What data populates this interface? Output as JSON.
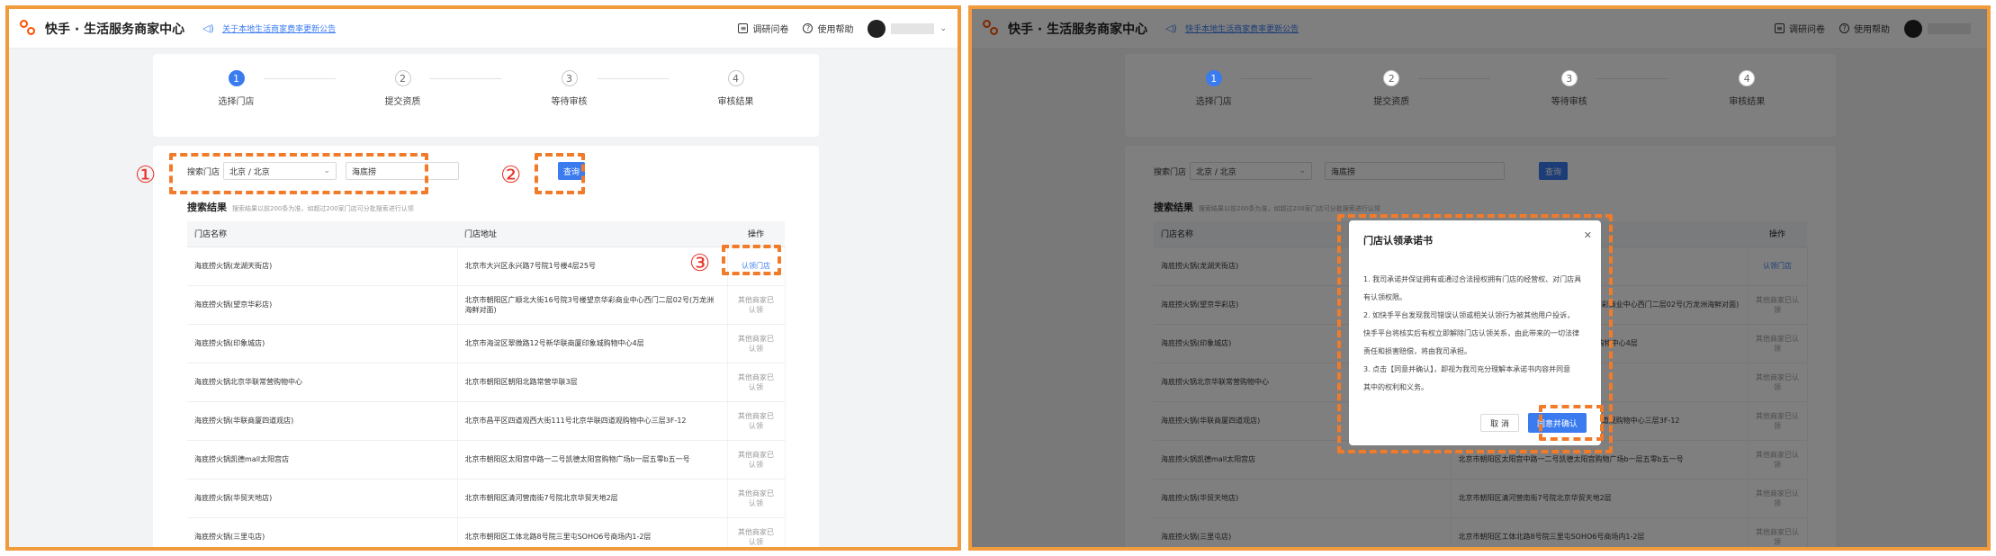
{
  "header": {
    "brand": "快手 · 生活服务商家中心",
    "notice_left": "关于本地生活商家费率更新公告",
    "notice_right": "快手本地生活商家费率更新公告",
    "survey": "调研问卷",
    "help": "使用帮助"
  },
  "steps": [
    {
      "num": "1",
      "label": "选择门店"
    },
    {
      "num": "2",
      "label": "提交资质"
    },
    {
      "num": "3",
      "label": "等待审核"
    },
    {
      "num": "4",
      "label": "审核结果"
    }
  ],
  "search": {
    "label": "搜索门店",
    "region": "北京 / 北京",
    "keyword": "海底捞",
    "button": "查询"
  },
  "results": {
    "title": "搜索结果",
    "hint": "搜索结果以前200条为准，如超过200家门店可分批搜索进行认领",
    "columns": [
      "门店名称",
      "门店地址",
      "操作"
    ],
    "rows": [
      {
        "name": "海底捞火锅(龙湖天街店)",
        "address": "北京市大兴区永兴路7号院1号楼4层25号",
        "action": "认领门店",
        "claimable": true
      },
      {
        "name": "海底捞火锅(望京华彩店)",
        "address": "北京市朝阳区广顺北大街16号院3号楼望京华彩商业中心西门二层02号(万龙洲海鲜对面)",
        "action": "其他商家已认领",
        "claimable": false
      },
      {
        "name": "海底捞火锅(印象城店)",
        "address": "北京市海淀区翠微路12号新华联商厦印象城购物中心4层",
        "action": "其他商家已认领",
        "claimable": false
      },
      {
        "name": "海底捞火锅北京华联常营购物中心",
        "address": "北京市朝阳区朝阳北路常营华联3层",
        "action": "其他商家已认领",
        "claimable": false
      },
      {
        "name": "海底捞火锅(华联商厦四道观店)",
        "address": "北京市昌平区四道观西大街111号北京华联四道观购物中心三层3F-12",
        "action": "其他商家已认领",
        "claimable": false
      },
      {
        "name": "海底捞火锅凯德mall太阳宫店",
        "address": "北京市朝阳区太阳宫中路一二号凯德太阳宫购物广场b一层五零b五一号",
        "action": "其他商家已认领",
        "claimable": false
      },
      {
        "name": "海底捞火锅(华贸天地店)",
        "address": "北京市朝阳区清河营南街7号院北京华贸天地2层",
        "action": "其他商家已认领",
        "claimable": false
      },
      {
        "name": "海底捞火锅(三里屯店)",
        "address": "北京市朝阳区工体北路8号院三里屯SOHO6号商场内1-2层",
        "action": "其他商家已认领",
        "claimable": false
      }
    ]
  },
  "modal": {
    "title": "门店认领承诺书",
    "paragraphs": [
      "1. 我司承诺并保证拥有或通过合法授权拥有门店的经营权、对门店具有认领权限。",
      "2. 如快手平台发现我司错误认领或相关认领行为被其他用户投诉，",
      "快手平台将核实后有权立即解除门店认领关系，由此带来的一切法律",
      "责任和损害赔偿，将由我司承担。",
      "3. 点击【同意并确认】，即视为我司充分理解本承诺书内容并同意",
      "其中的权利和义务。"
    ],
    "cancel": "取 消",
    "confirm": "同意并确认"
  },
  "annotations": {
    "mark1": "①",
    "mark2": "②",
    "mark3": "③"
  },
  "colors": {
    "accent": "#3a7bf0",
    "frame": "#f29b3c",
    "dash": "#f27b2a",
    "marker": "#e8352c"
  }
}
